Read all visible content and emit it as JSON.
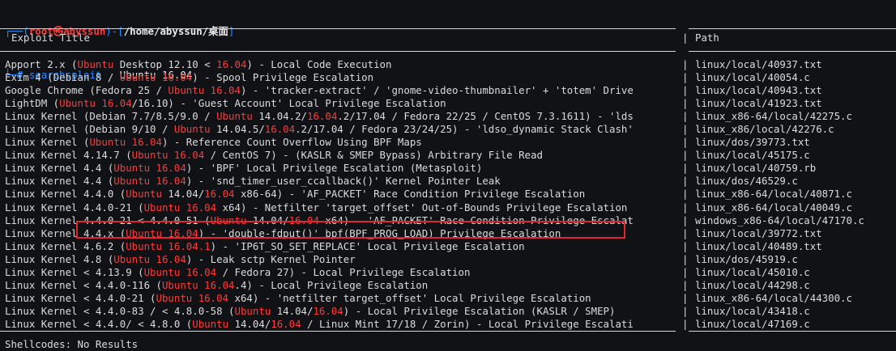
{
  "prompt": {
    "line1_bar": "┌──(",
    "line1_user": "root㉿abyssun",
    "line1_mid": ")-[",
    "line1_path": "/home/abyssun/桌面",
    "line1_end": "]",
    "line2_bar": "└─",
    "line2_hash": "#",
    "command_name": "searchsploit",
    "command_args": "Ubuntu 16.04"
  },
  "table": {
    "header_title": "Exploit Title",
    "header_sep": "|",
    "header_path": "Path",
    "rows": [
      {
        "parts": [
          {
            "t": "Apport 2.x ("
          },
          {
            "t": "Ubuntu",
            "h": true
          },
          {
            "t": " Desktop 12.10 < "
          },
          {
            "t": "16.04",
            "h": true
          },
          {
            "t": ") - Local Code Execution"
          }
        ],
        "path": "linux/local/40937.txt"
      },
      {
        "parts": [
          {
            "t": "Exim 4 (Debian 8 / "
          },
          {
            "t": "Ubuntu 16.04",
            "h": true
          },
          {
            "t": ") - Spool Privilege Escalation"
          }
        ],
        "path": "linux/local/40054.c"
      },
      {
        "parts": [
          {
            "t": "Google Chrome (Fedora 25 / "
          },
          {
            "t": "Ubuntu 16.04",
            "h": true
          },
          {
            "t": ") - 'tracker-extract' / 'gnome-video-thumbnailer' + 'totem' Drive"
          }
        ],
        "path": "linux/local/40943.txt"
      },
      {
        "parts": [
          {
            "t": "LightDM ("
          },
          {
            "t": "Ubuntu 16.04",
            "h": true
          },
          {
            "t": "/16.10) - 'Guest Account' Local Privilege Escalation"
          }
        ],
        "path": "linux/local/41923.txt"
      },
      {
        "parts": [
          {
            "t": "Linux Kernel (Debian 7.7/8.5/9.0 / "
          },
          {
            "t": "Ubuntu",
            "h": true
          },
          {
            "t": " 14.04.2/"
          },
          {
            "t": "16.04",
            "h": true
          },
          {
            "t": ".2/17.04 / Fedora 22/25 / CentOS 7.3.1611) - 'lds"
          }
        ],
        "path": "linux_x86-64/local/42275.c"
      },
      {
        "parts": [
          {
            "t": "Linux Kernel (Debian 9/10 / "
          },
          {
            "t": "Ubuntu",
            "h": true
          },
          {
            "t": " 14.04.5/"
          },
          {
            "t": "16.04",
            "h": true
          },
          {
            "t": ".2/17.04 / Fedora 23/24/25) - 'ldso_dynamic Stack Clash'"
          }
        ],
        "path": "linux_x86/local/42276.c"
      },
      {
        "parts": [
          {
            "t": "Linux Kernel ("
          },
          {
            "t": "Ubuntu 16.04",
            "h": true
          },
          {
            "t": ") - Reference Count Overflow Using BPF Maps"
          }
        ],
        "path": "linux/dos/39773.txt"
      },
      {
        "parts": [
          {
            "t": "Linux Kernel 4.14.7 ("
          },
          {
            "t": "Ubuntu 16.04",
            "h": true
          },
          {
            "t": " / CentOS 7) - (KASLR & SMEP Bypass) Arbitrary File Read"
          }
        ],
        "path": "linux/local/45175.c"
      },
      {
        "parts": [
          {
            "t": "Linux Kernel 4.4 ("
          },
          {
            "t": "Ubuntu 16.04",
            "h": true
          },
          {
            "t": ") - 'BPF' Local Privilege Escalation (Metasploit)"
          }
        ],
        "path": "linux/local/40759.rb"
      },
      {
        "parts": [
          {
            "t": "Linux Kernel 4.4 ("
          },
          {
            "t": "Ubuntu 16.04",
            "h": true
          },
          {
            "t": ") - 'snd_timer_user_ccallback()' Kernel Pointer Leak"
          }
        ],
        "path": "linux/dos/46529.c"
      },
      {
        "parts": [
          {
            "t": "Linux Kernel 4.4.0 ("
          },
          {
            "t": "Ubuntu",
            "h": true
          },
          {
            "t": " 14.04/"
          },
          {
            "t": "16.04",
            "h": true
          },
          {
            "t": " x86-64) - 'AF_PACKET' Race Condition Privilege Escalation"
          }
        ],
        "path": "linux_x86-64/local/40871.c"
      },
      {
        "parts": [
          {
            "t": "Linux Kernel 4.4.0-21 ("
          },
          {
            "t": "Ubuntu 16.04",
            "h": true
          },
          {
            "t": " x64) - Netfilter 'target_offset' Out-of-Bounds Privilege Escalation"
          }
        ],
        "path": "linux_x86-64/local/40049.c"
      },
      {
        "parts": [
          {
            "t": "Linux Kernel 4.4.0-21 < 4.4.0-51 ("
          },
          {
            "t": "Ubuntu",
            "h": true
          },
          {
            "t": " 14.04/"
          },
          {
            "t": "16.04",
            "h": true
          },
          {
            "t": " x64) - 'AF_PACKET' Race Condition Privilege Escalat"
          }
        ],
        "path": "windows_x86-64/local/47170.c"
      },
      {
        "parts": [
          {
            "t": "Linux Kernel 4.4.x ("
          },
          {
            "t": "Ubuntu 16.04",
            "h": true
          },
          {
            "t": ") - 'double-fdput()' bpf(BPF_PROG_LOAD) Privilege Escalation"
          }
        ],
        "path": "linux/local/39772.txt"
      },
      {
        "parts": [
          {
            "t": "Linux Kernel 4.6.2 ("
          },
          {
            "t": "Ubuntu 16.04.1",
            "h": true
          },
          {
            "t": ") - 'IP6T_SO_SET_REPLACE' Local Privilege Escalation"
          }
        ],
        "path": "linux/local/40489.txt"
      },
      {
        "parts": [
          {
            "t": "Linux Kernel 4.8 ("
          },
          {
            "t": "Ubuntu 16.04",
            "h": true
          },
          {
            "t": ") - Leak sctp Kernel Pointer"
          }
        ],
        "path": "linux/dos/45919.c"
      },
      {
        "parts": [
          {
            "t": "Linux Kernel < 4.13.9 ("
          },
          {
            "t": "Ubuntu 16.04",
            "h": true
          },
          {
            "t": " / Fedora 27) - Local Privilege Escalation"
          }
        ],
        "path": "linux/local/45010.c"
      },
      {
        "parts": [
          {
            "t": "Linux Kernel < 4.4.0-116 ("
          },
          {
            "t": "Ubuntu 16.04",
            "h": true
          },
          {
            "t": ".4) - Local Privilege Escalation"
          }
        ],
        "path": "linux/local/44298.c"
      },
      {
        "parts": [
          {
            "t": "Linux Kernel < 4.4.0-21 ("
          },
          {
            "t": "Ubuntu 16.04",
            "h": true
          },
          {
            "t": " x64) - 'netfilter target_offset' Local Privilege Escalation"
          }
        ],
        "path": "linux_x86-64/local/44300.c"
      },
      {
        "parts": [
          {
            "t": "Linux Kernel < 4.4.0-83 / < 4.8.0-58 ("
          },
          {
            "t": "Ubuntu",
            "h": true
          },
          {
            "t": " 14.04/"
          },
          {
            "t": "16.04",
            "h": true
          },
          {
            "t": ") - Local Privilege Escalation (KASLR / SMEP)"
          }
        ],
        "path": "linux/local/43418.c"
      },
      {
        "parts": [
          {
            "t": "Linux Kernel < 4.4.0/ < 4.8.0 ("
          },
          {
            "t": "Ubuntu",
            "h": true
          },
          {
            "t": " 14.04/"
          },
          {
            "t": "16.04",
            "h": true
          },
          {
            "t": " / Linux Mint 17/18 / Zorin) - Local Privilege Escalati"
          }
        ],
        "path": "linux/local/47169.c"
      }
    ],
    "row_sep": "|"
  },
  "footer": {
    "shellcodes": "Shellcodes: No Results"
  },
  "colors": {
    "background": "#101216",
    "text": "#dcdcdc",
    "match_highlight": "#ff3b3b",
    "annotation_box": "#e0262b",
    "prompt_blue": "#2f8cff"
  }
}
